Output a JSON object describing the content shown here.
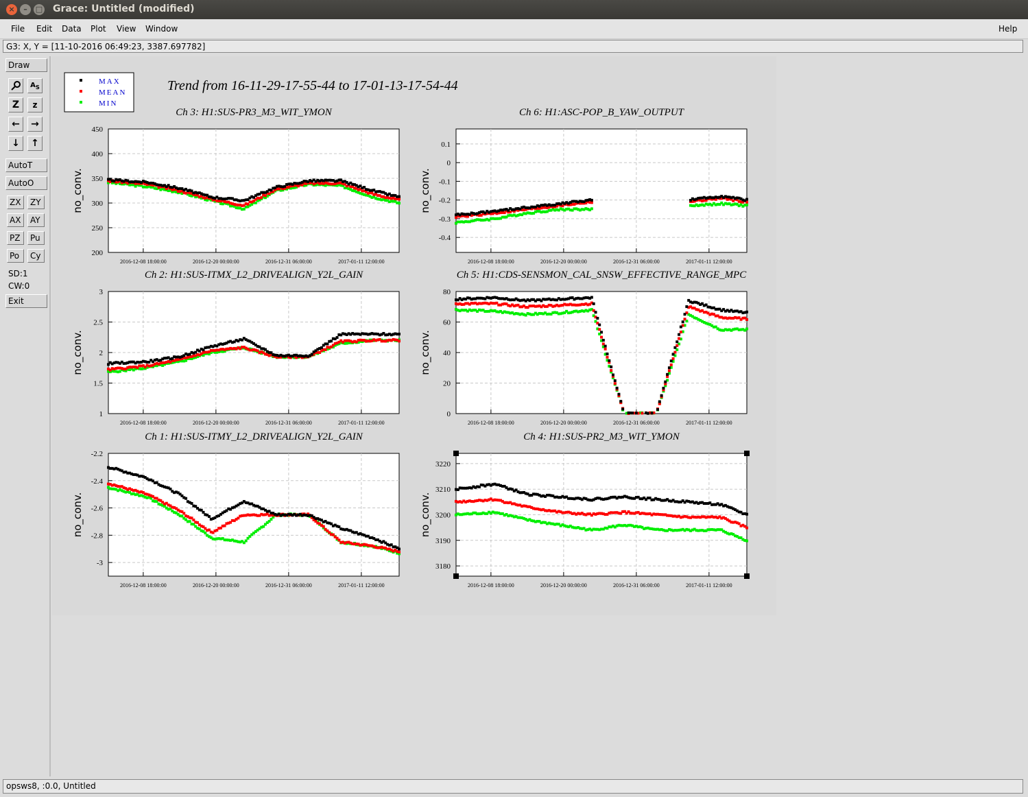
{
  "window": {
    "title": "Grace: Untitled (modified)"
  },
  "menu": {
    "items": [
      "File",
      "Edit",
      "Data",
      "Plot",
      "View",
      "Window"
    ],
    "help": "Help"
  },
  "locator": "G3: X, Y = [11-10-2016 06:49:23, 3387.697782]",
  "toolbar": {
    "draw": "Draw",
    "autot": "AutoT",
    "autoo": "AutoO",
    "pair_buttons": [
      [
        "ZX",
        "ZY"
      ],
      [
        "AX",
        "AY"
      ],
      [
        "PZ",
        "Pu"
      ],
      [
        "Po",
        "Cy"
      ]
    ],
    "sd": "SD:1",
    "cw": "CW:0",
    "exit": "Exit"
  },
  "status": "opsws8, :0.0, Untitled",
  "main_title": "Trend from 16-11-29-17-55-44 to 17-01-13-17-54-44",
  "legend": [
    "MAX",
    "MEAN",
    "MIN"
  ],
  "colors": {
    "max": "#000000",
    "mean": "#ff0000",
    "min": "#00ee00"
  },
  "x_ticks": [
    "2016-12-08 18:00:00",
    "2016-12-20 00:00:00",
    "2016-12-31 06:00:00",
    "2017-01-11 12:00:00"
  ],
  "ylabel": "no_conv.",
  "chart_data": [
    {
      "type": "scatter",
      "title": "Ch 3: H1:SUS-PR3_M3_WIT_YMON",
      "ylabel": "no_conv.",
      "yticks": [
        450,
        400,
        350,
        300,
        250,
        200
      ],
      "ylim": [
        200,
        450
      ],
      "x": [
        "2016-11-29",
        "2016-12-05",
        "2016-12-10",
        "2016-12-15",
        "2016-12-20",
        "2016-12-25",
        "2016-12-30",
        "2017-01-04",
        "2017-01-09",
        "2017-01-13"
      ],
      "series": [
        {
          "name": "MAX",
          "values": [
            347,
            342,
            330,
            312,
            305,
            332,
            345,
            345,
            325,
            312
          ]
        },
        {
          "name": "MEAN",
          "values": [
            345,
            338,
            325,
            308,
            295,
            328,
            340,
            340,
            318,
            306
          ]
        },
        {
          "name": "MIN",
          "values": [
            342,
            333,
            322,
            305,
            288,
            325,
            338,
            335,
            312,
            300
          ]
        }
      ]
    },
    {
      "type": "scatter",
      "title": "Ch 6: H1:ASC-POP_B_YAW_OUTPUT",
      "ylabel": "no_conv.",
      "yticks": [
        0.1,
        0,
        -0.1,
        -0.2,
        -0.3,
        -0.4
      ],
      "ylim": [
        -0.48,
        0.18
      ],
      "x": [
        "2016-11-29",
        "2016-12-05",
        "2016-12-10",
        "2016-12-15",
        "2016-12-20",
        "2016-12-25",
        "2016-12-30",
        "2017-01-04",
        "2017-01-09",
        "2017-01-13"
      ],
      "series": [
        {
          "name": "MAX",
          "values": [
            -0.28,
            -0.26,
            -0.24,
            -0.22,
            -0.2,
            null,
            null,
            -0.2,
            -0.18,
            -0.2
          ]
        },
        {
          "name": "MEAN",
          "values": [
            -0.29,
            -0.27,
            -0.25,
            -0.23,
            -0.21,
            null,
            null,
            -0.21,
            -0.19,
            -0.21
          ]
        },
        {
          "name": "MIN",
          "values": [
            -0.32,
            -0.3,
            -0.27,
            -0.25,
            -0.25,
            null,
            null,
            -0.23,
            -0.22,
            -0.23
          ]
        }
      ]
    },
    {
      "type": "scatter",
      "title": "Ch 2: H1:SUS-ITMX_L2_DRIVEALIGN_Y2L_GAIN",
      "ylabel": "no_conv.",
      "yticks": [
        3,
        2.5,
        2,
        1.5,
        1
      ],
      "ylim": [
        1,
        3
      ],
      "x": [
        "2016-11-29",
        "2016-12-05",
        "2016-12-10",
        "2016-12-15",
        "2016-12-20",
        "2016-12-25",
        "2016-12-30",
        "2017-01-04",
        "2017-01-09",
        "2017-01-13"
      ],
      "series": [
        {
          "name": "MAX",
          "values": [
            1.82,
            1.85,
            1.93,
            2.1,
            2.22,
            1.95,
            1.95,
            2.3,
            2.3,
            2.3
          ]
        },
        {
          "name": "MEAN",
          "values": [
            1.72,
            1.78,
            1.88,
            2.03,
            2.08,
            1.93,
            1.93,
            2.18,
            2.2,
            2.2
          ]
        },
        {
          "name": "MIN",
          "values": [
            1.68,
            1.75,
            1.85,
            2.0,
            2.08,
            1.93,
            1.93,
            2.15,
            2.2,
            2.2
          ]
        }
      ]
    },
    {
      "type": "scatter",
      "title": "Ch 5: H1:CDS-SENSMON_CAL_SNSW_EFFECTIVE_RANGE_MPC",
      "ylabel": "no_conv.",
      "yticks": [
        80,
        60,
        40,
        20,
        0
      ],
      "ylim": [
        0,
        80
      ],
      "x": [
        "2016-11-29",
        "2016-12-05",
        "2016-12-10",
        "2016-12-15",
        "2016-12-20",
        "2016-12-25",
        "2016-12-30",
        "2017-01-04",
        "2017-01-09",
        "2017-01-13"
      ],
      "series": [
        {
          "name": "MAX",
          "values": [
            75,
            76,
            74,
            75,
            76,
            0,
            0,
            74,
            68,
            66
          ]
        },
        {
          "name": "MEAN",
          "values": [
            72,
            72,
            70,
            71,
            72,
            0,
            0,
            70,
            63,
            62
          ]
        },
        {
          "name": "MIN",
          "values": [
            68,
            67,
            65,
            66,
            68,
            0,
            0,
            65,
            55,
            55
          ]
        }
      ]
    },
    {
      "type": "scatter",
      "title": "Ch 1: H1:SUS-ITMY_L2_DRIVEALIGN_Y2L_GAIN",
      "ylabel": "no_conv.",
      "yticks": [
        -2.2,
        -2.4,
        -2.6,
        -2.8,
        -3
      ],
      "ylim": [
        -3.1,
        -2.2
      ],
      "x": [
        "2016-11-29",
        "2016-12-05",
        "2016-12-10",
        "2016-12-15",
        "2016-12-20",
        "2016-12-25",
        "2016-12-30",
        "2017-01-04",
        "2017-01-09",
        "2017-01-13"
      ],
      "series": [
        {
          "name": "MAX",
          "values": [
            -2.3,
            -2.38,
            -2.5,
            -2.68,
            -2.55,
            -2.65,
            -2.65,
            -2.75,
            -2.82,
            -2.9
          ]
        },
        {
          "name": "MEAN",
          "values": [
            -2.42,
            -2.5,
            -2.62,
            -2.78,
            -2.65,
            -2.65,
            -2.65,
            -2.85,
            -2.88,
            -2.92
          ]
        },
        {
          "name": "MIN",
          "values": [
            -2.45,
            -2.52,
            -2.65,
            -2.82,
            -2.85,
            -2.65,
            -2.65,
            -2.85,
            -2.88,
            -2.93
          ]
        }
      ]
    },
    {
      "type": "scatter",
      "title": "Ch 4: H1:SUS-PR2_M3_WIT_YMON",
      "ylabel": "no_conv.",
      "yticks": [
        3220,
        3210,
        3200,
        3190,
        3180
      ],
      "ylim": [
        3176,
        3224
      ],
      "x": [
        "2016-11-29",
        "2016-12-05",
        "2016-12-10",
        "2016-12-15",
        "2016-12-20",
        "2016-12-25",
        "2016-12-30",
        "2017-01-04",
        "2017-01-09",
        "2017-01-13"
      ],
      "series": [
        {
          "name": "MAX",
          "values": [
            3210,
            3212,
            3208,
            3207,
            3206,
            3207,
            3206,
            3205,
            3204,
            3200
          ]
        },
        {
          "name": "MEAN",
          "values": [
            3205,
            3206,
            3203,
            3201,
            3200,
            3201,
            3200,
            3199,
            3199,
            3195
          ]
        },
        {
          "name": "MIN",
          "values": [
            3200,
            3201,
            3198,
            3196,
            3194,
            3196,
            3194,
            3194,
            3194,
            3190
          ]
        }
      ]
    }
  ]
}
